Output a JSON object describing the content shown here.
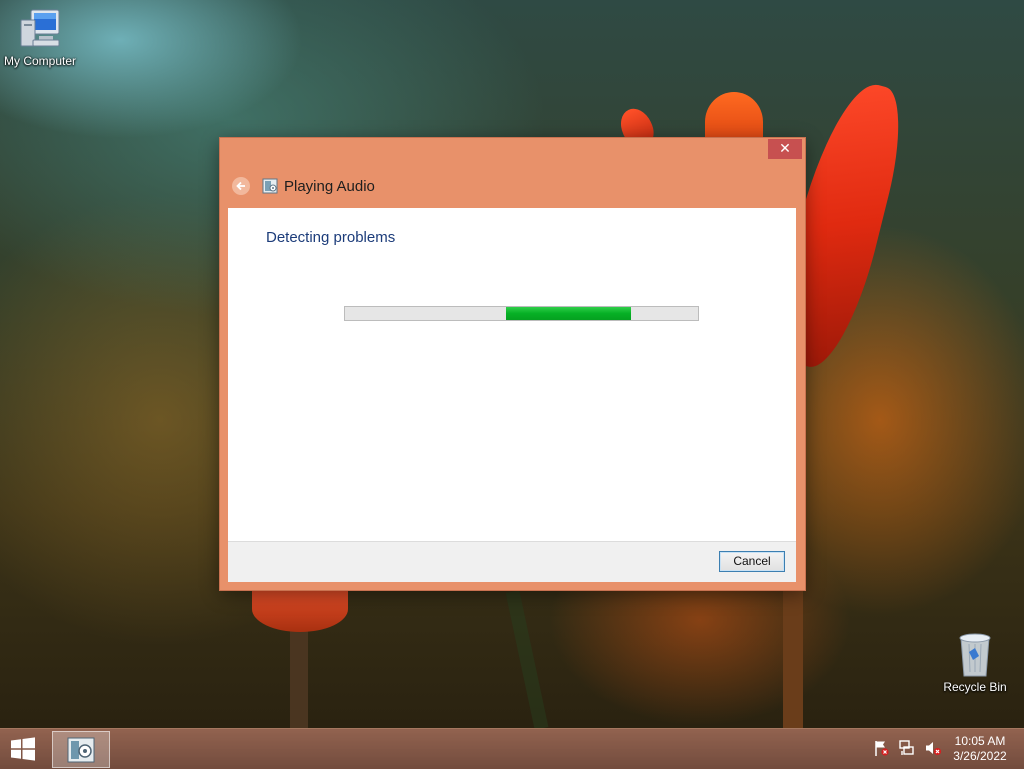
{
  "desktop": {
    "icons": [
      {
        "label": "My Computer",
        "icon": "computer-icon"
      },
      {
        "label": "Recycle Bin",
        "icon": "recycle-bin-icon"
      }
    ]
  },
  "dialog": {
    "title": "Playing Audio",
    "close_label": "✕",
    "heading": "Detecting problems",
    "progress": {
      "start_fraction": 0.455,
      "end_fraction": 0.81,
      "color": "#06b025",
      "indeterminate": true
    },
    "cancel_label": "Cancel",
    "accent": "#e8916a"
  },
  "taskbar": {
    "clock_time": "10:05 AM",
    "clock_date": "3/26/2022",
    "tray_icons": [
      "action-center-flag-icon",
      "network-icon",
      "volume-muted-icon"
    ]
  }
}
